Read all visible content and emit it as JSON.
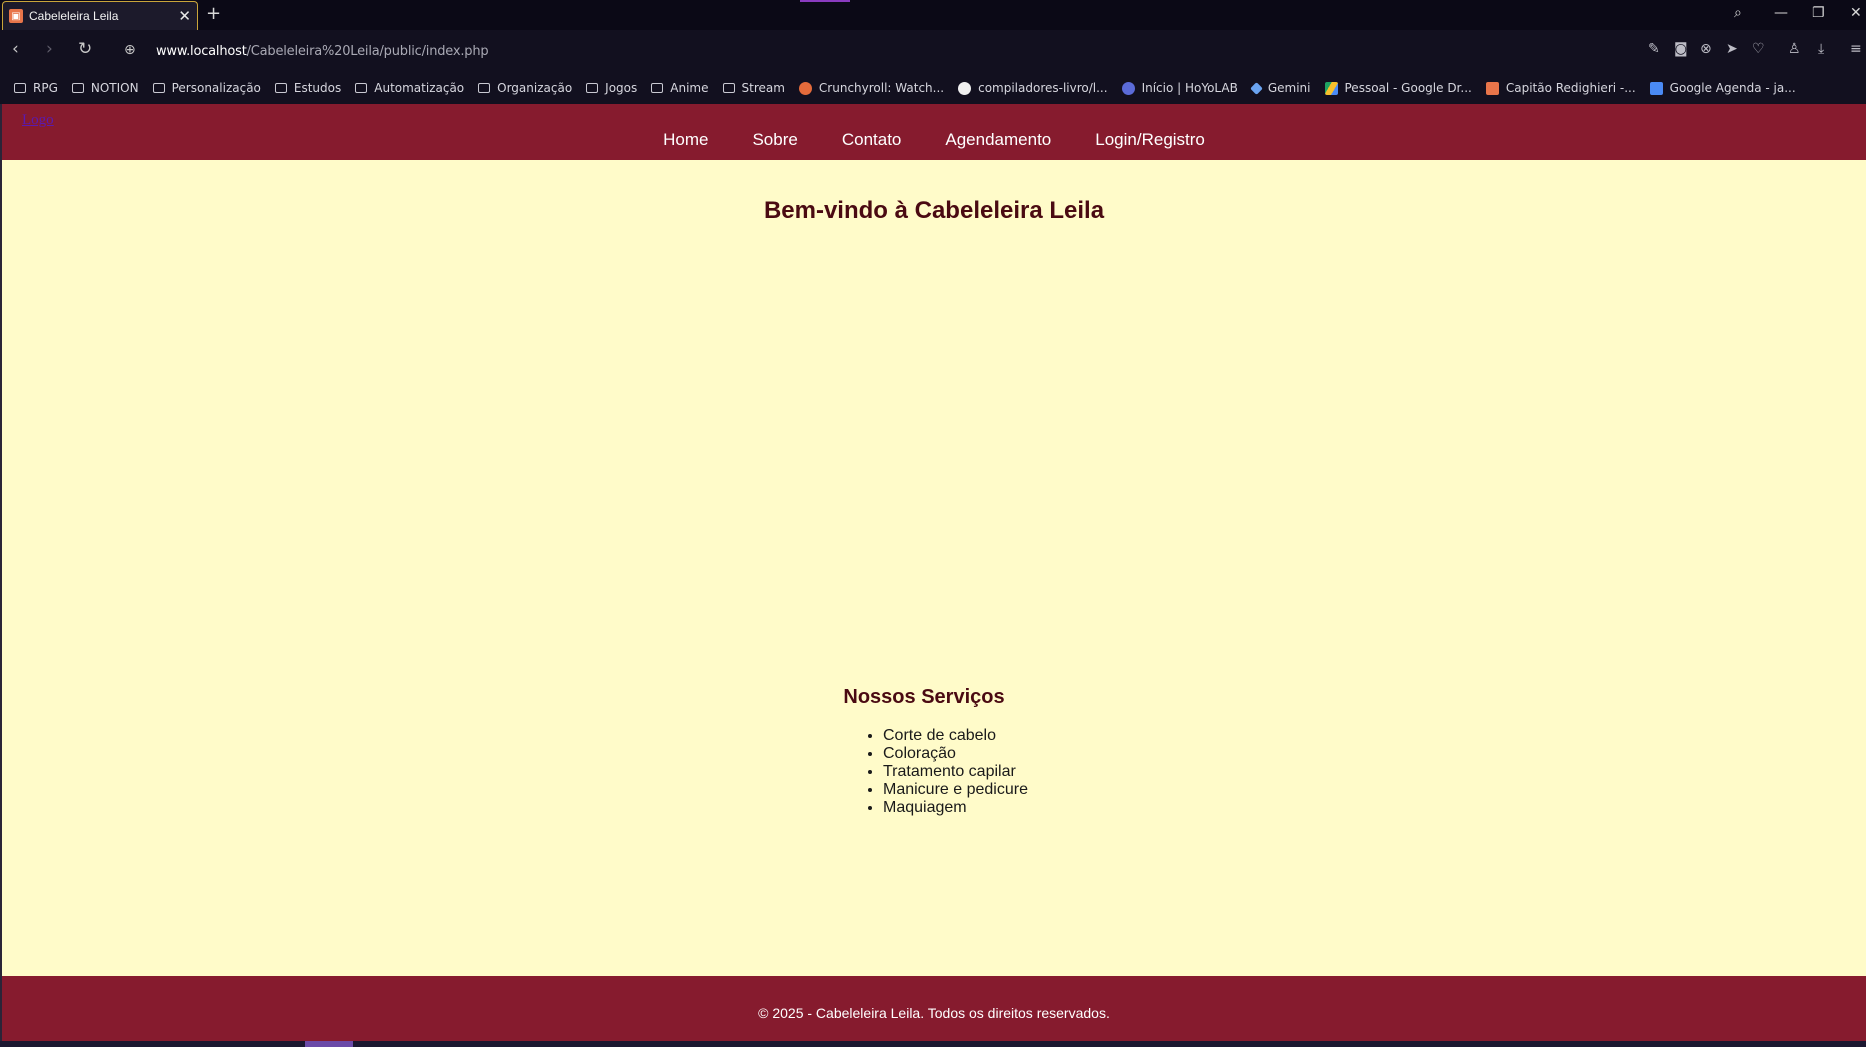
{
  "browser": {
    "tab_title": "Cabeleleira Leila",
    "tab_close": "✕",
    "new_tab": "+",
    "url_host": "www.localhost",
    "url_path": "/Cabeleleira%20Leila/public/index.php",
    "bookmarks": [
      {
        "label": "RPG",
        "icon": "folder-icon"
      },
      {
        "label": "NOTION",
        "icon": "folder-icon"
      },
      {
        "label": "Personalização",
        "icon": "folder-icon"
      },
      {
        "label": "Estudos",
        "icon": "folder-icon"
      },
      {
        "label": "Automatização",
        "icon": "folder-icon"
      },
      {
        "label": "Organização",
        "icon": "folder-icon"
      },
      {
        "label": "Jogos",
        "icon": "folder-icon"
      },
      {
        "label": "Anime",
        "icon": "folder-icon"
      },
      {
        "label": "Stream",
        "icon": "folder-icon"
      },
      {
        "label": "Crunchyroll: Watch...",
        "icon": "crunchyroll-icon"
      },
      {
        "label": "compiladores-livro/l...",
        "icon": "github-icon"
      },
      {
        "label": "Início | HoYoLAB",
        "icon": "hoyolab-icon"
      },
      {
        "label": "Gemini",
        "icon": "gemini-icon"
      },
      {
        "label": "Pessoal - Google Dr...",
        "icon": "google-drive-icon"
      },
      {
        "label": "Capitão Redighieri -...",
        "icon": "site-icon"
      },
      {
        "label": "Google Agenda - ja...",
        "icon": "google-calendar-icon"
      }
    ]
  },
  "site": {
    "logo": "Logo",
    "nav": [
      "Home",
      "Sobre",
      "Contato",
      "Agendamento",
      "Login/Registro"
    ],
    "welcome": "Bem-vindo à Cabeleleira Leila",
    "services_title": "Nossos Serviços",
    "services": [
      "Corte de cabelo",
      "Coloração",
      "Tratamento capilar",
      "Manicure e pedicure",
      "Maquiagem"
    ],
    "footer": "© 2025 - Cabeleleira Leila. Todos os direitos reservados."
  },
  "colors": {
    "header_bg": "#861b2e",
    "page_bg": "#fffbc9",
    "heading": "#4a0a12"
  }
}
